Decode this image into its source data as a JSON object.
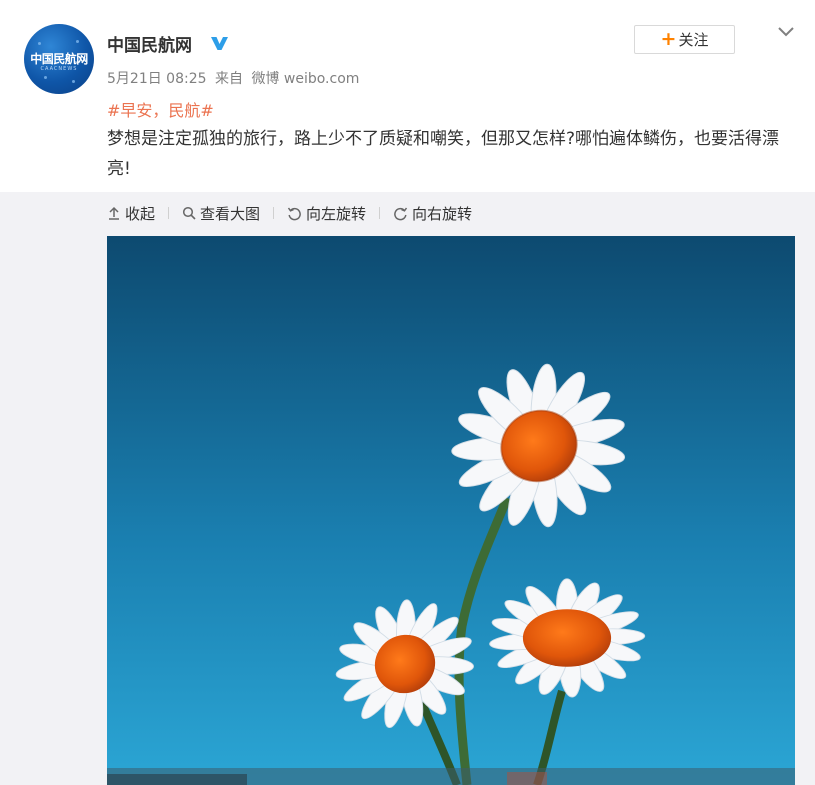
{
  "post": {
    "avatar_text": "中国民航网",
    "avatar_subtext": "CAACNEWS",
    "username": "中国民航网",
    "follow_label": "关注",
    "follow_plus": "+",
    "date": "5月21日 08:25",
    "from_label": "来自",
    "source": "微博 weibo.com",
    "hashtag": "#早安，民航#",
    "text": "梦想是注定孤独的旅行，路上少不了质疑和嘲笑，但那又怎样?哪怕遍体鳞伤，也要活得漂亮!"
  },
  "media_toolbar": {
    "collapse": "收起",
    "view_large": "查看大图",
    "rotate_left": "向左旋转",
    "rotate_right": "向右旋转"
  },
  "icons": {
    "verified": "verified-v-icon",
    "more": "chevron-down-icon",
    "collapse": "arrow-up-icon",
    "view_large": "magnifier-icon",
    "rotate_left": "rotate-left-icon",
    "rotate_right": "rotate-right-icon"
  },
  "colors": {
    "hashtag": "#eb7350",
    "follow_plus": "#ff8200",
    "meta_text": "#808080",
    "verified": "#2d9ee8",
    "media_background": "#f2f2f5",
    "sky_top": "#0d4a70",
    "sky_bottom": "#2ba6d5"
  }
}
